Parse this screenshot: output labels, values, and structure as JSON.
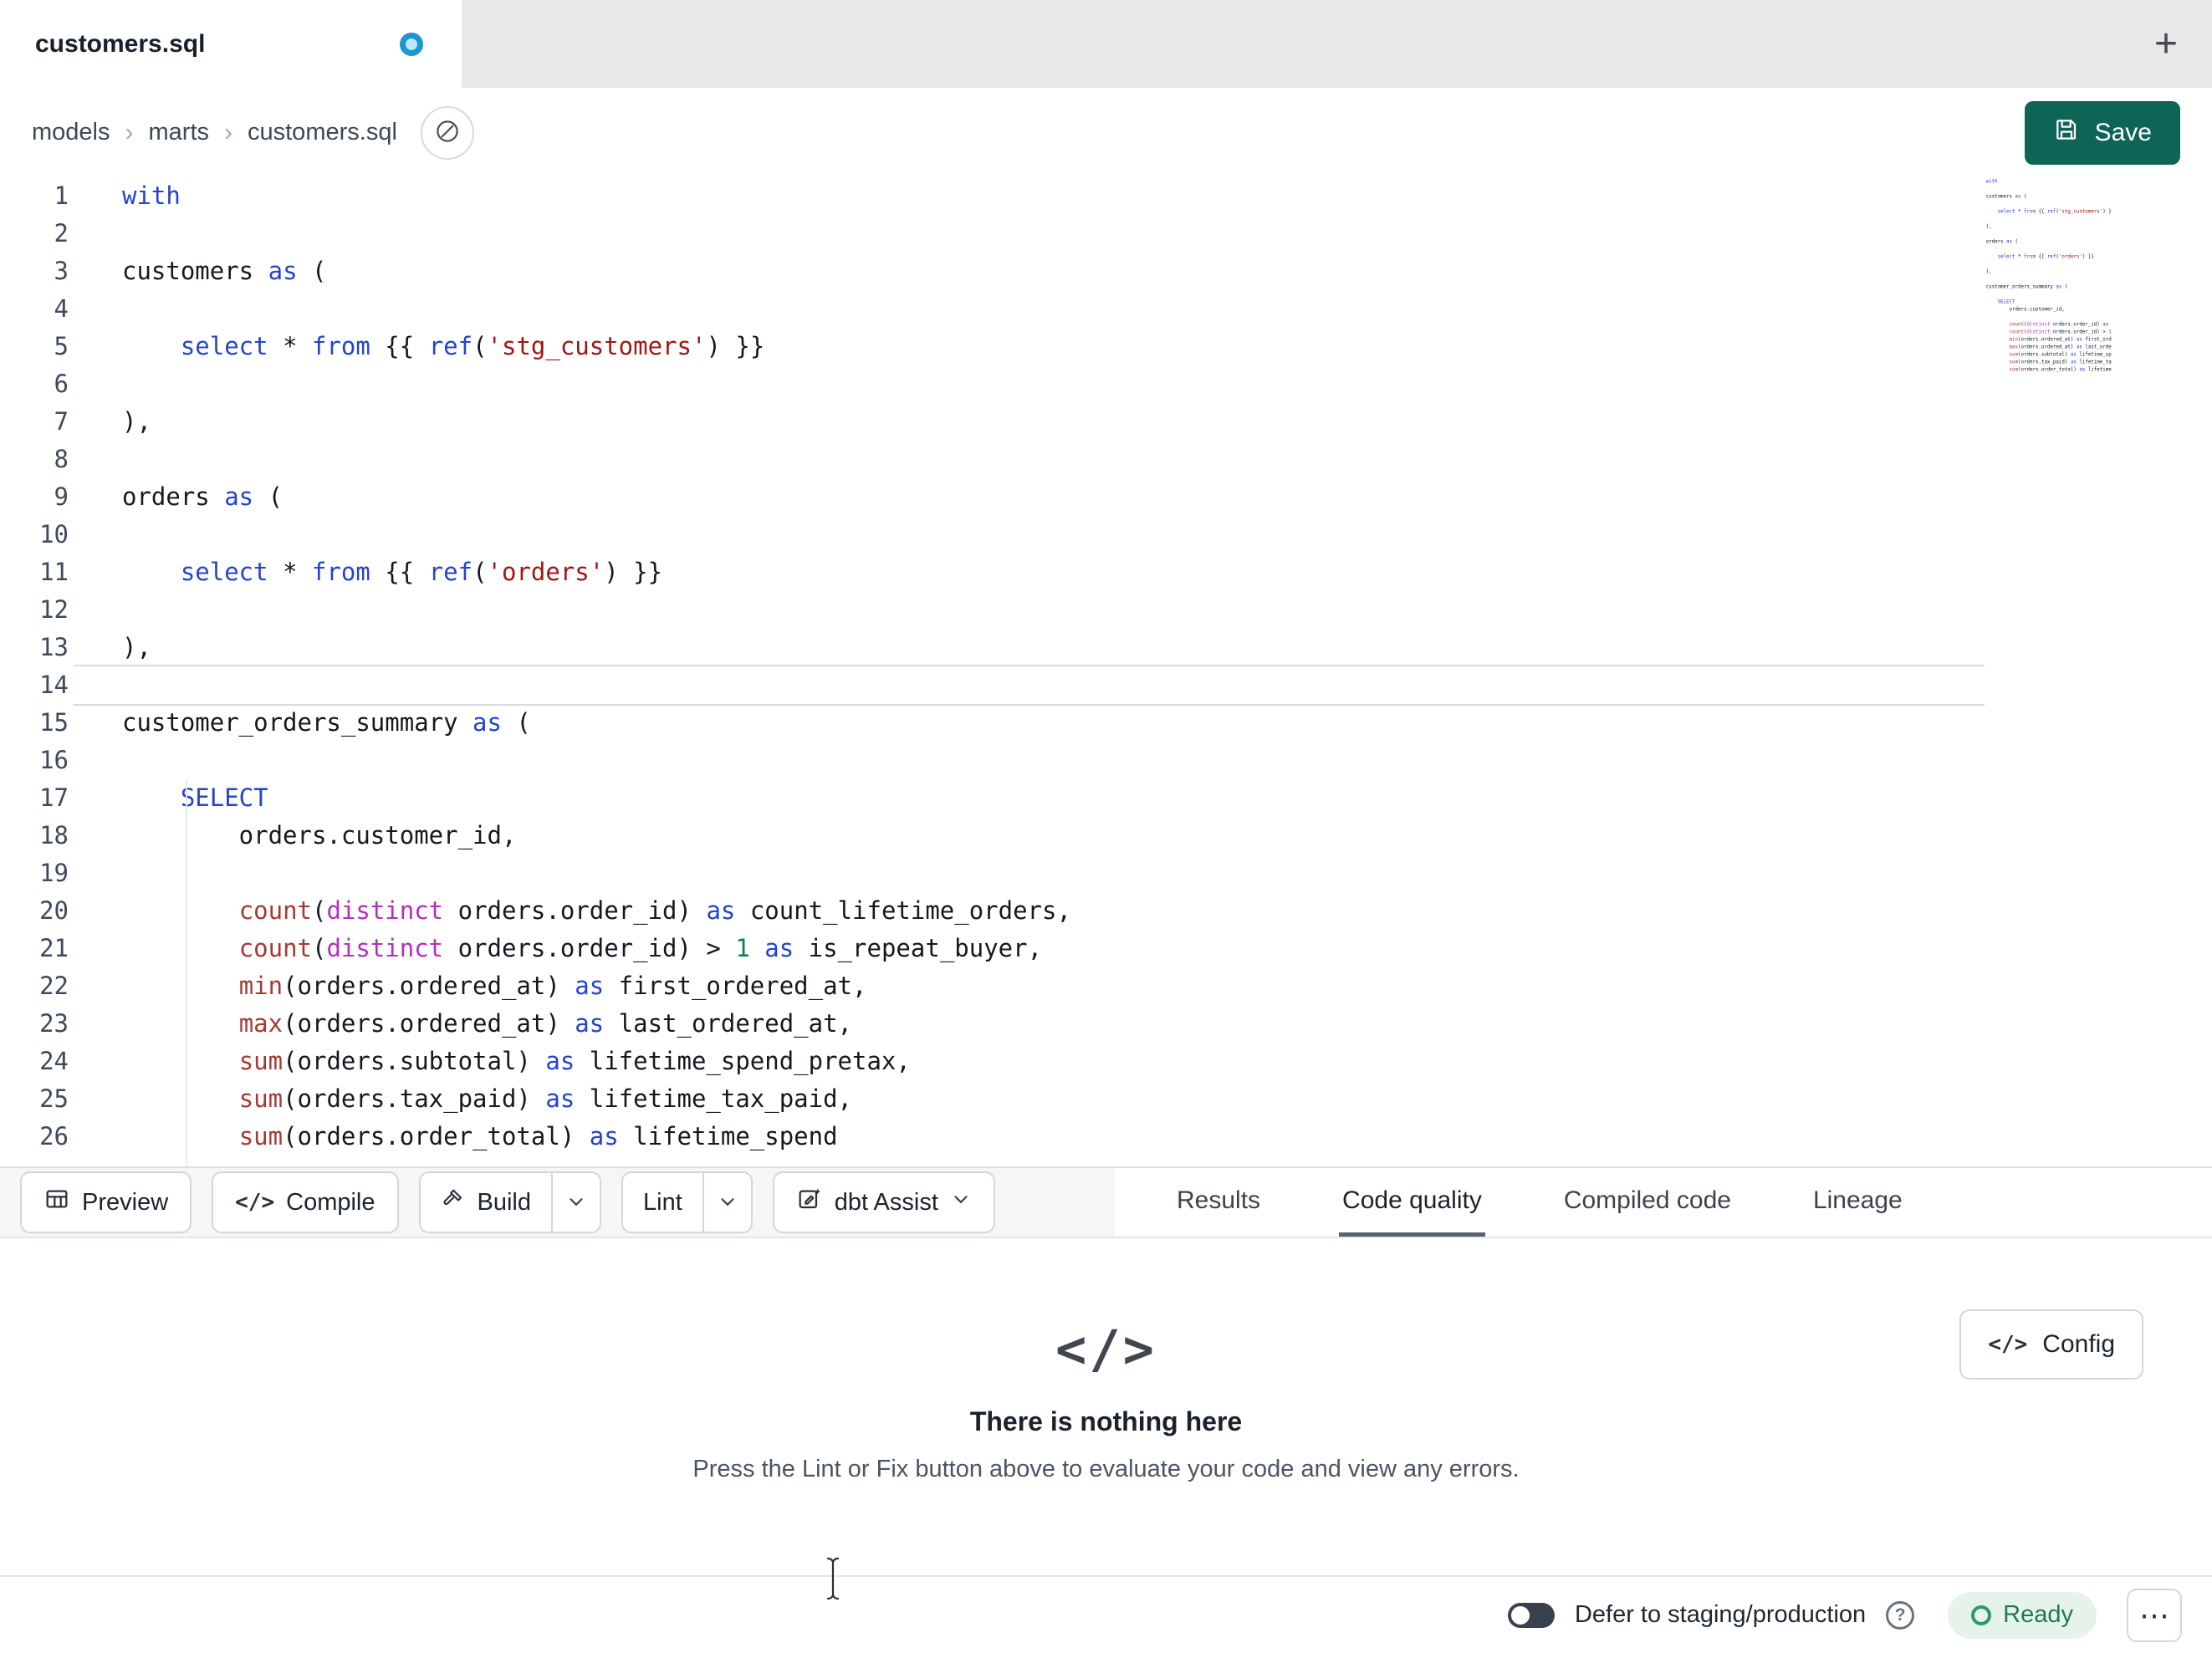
{
  "window": {
    "tab_title": "customers.sql",
    "new_tab": "+"
  },
  "breadcrumb": {
    "items": [
      "models",
      "marts",
      "customers.sql"
    ],
    "separator": "›"
  },
  "actions": {
    "save": "Save"
  },
  "editor": {
    "active_line": 14,
    "lines": [
      {
        "n": 1,
        "s": [
          [
            "with",
            "kw"
          ]
        ]
      },
      {
        "n": 2,
        "s": []
      },
      {
        "n": 3,
        "s": [
          [
            "customers ",
            "pl"
          ],
          [
            "as",
            "kw"
          ],
          [
            " (",
            "pl"
          ]
        ]
      },
      {
        "n": 4,
        "s": []
      },
      {
        "n": 5,
        "s": [
          [
            "    ",
            "pl"
          ],
          [
            "select",
            "kw"
          ],
          [
            " * ",
            "pl"
          ],
          [
            "from",
            "kw"
          ],
          [
            " {{ ",
            "pl"
          ],
          [
            "ref",
            "kw"
          ],
          [
            "(",
            "pl"
          ],
          [
            "'stg_customers'",
            "str"
          ],
          [
            ") }}",
            "pl"
          ]
        ]
      },
      {
        "n": 6,
        "s": []
      },
      {
        "n": 7,
        "s": [
          [
            "),",
            "pl"
          ]
        ]
      },
      {
        "n": 8,
        "s": []
      },
      {
        "n": 9,
        "s": [
          [
            "orders ",
            "pl"
          ],
          [
            "as",
            "kw"
          ],
          [
            " (",
            "pl"
          ]
        ]
      },
      {
        "n": 10,
        "s": []
      },
      {
        "n": 11,
        "s": [
          [
            "    ",
            "pl"
          ],
          [
            "select",
            "kw"
          ],
          [
            " * ",
            "pl"
          ],
          [
            "from",
            "kw"
          ],
          [
            " {{ ",
            "pl"
          ],
          [
            "ref",
            "kw"
          ],
          [
            "(",
            "pl"
          ],
          [
            "'orders'",
            "str"
          ],
          [
            ") }}",
            "pl"
          ]
        ]
      },
      {
        "n": 12,
        "s": []
      },
      {
        "n": 13,
        "s": [
          [
            "),",
            "pl"
          ]
        ]
      },
      {
        "n": 14,
        "s": []
      },
      {
        "n": 15,
        "s": [
          [
            "customer_orders_summary ",
            "pl"
          ],
          [
            "as",
            "kw"
          ],
          [
            " (",
            "pl"
          ]
        ]
      },
      {
        "n": 16,
        "s": []
      },
      {
        "n": 17,
        "s": [
          [
            "    ",
            "pl"
          ],
          [
            "SELECT",
            "kw"
          ]
        ]
      },
      {
        "n": 18,
        "s": [
          [
            "        orders.customer_id,",
            "pl"
          ]
        ]
      },
      {
        "n": 19,
        "s": []
      },
      {
        "n": 20,
        "s": [
          [
            "        ",
            "pl"
          ],
          [
            "count",
            "fn"
          ],
          [
            "(",
            "pl"
          ],
          [
            "distinct",
            "kw2"
          ],
          [
            " orders.order_id) ",
            "pl"
          ],
          [
            "as",
            "kw"
          ],
          [
            " count_lifetime_orders,",
            "pl"
          ]
        ]
      },
      {
        "n": 21,
        "s": [
          [
            "        ",
            "pl"
          ],
          [
            "count",
            "fn"
          ],
          [
            "(",
            "pl"
          ],
          [
            "distinct",
            "kw2"
          ],
          [
            " orders.order_id) > ",
            "pl"
          ],
          [
            "1",
            "num"
          ],
          [
            " ",
            "pl"
          ],
          [
            "as",
            "kw"
          ],
          [
            " is_repeat_buyer,",
            "pl"
          ]
        ]
      },
      {
        "n": 22,
        "s": [
          [
            "        ",
            "pl"
          ],
          [
            "min",
            "fn"
          ],
          [
            "(orders.ordered_at) ",
            "pl"
          ],
          [
            "as",
            "kw"
          ],
          [
            " first_ordered_at,",
            "pl"
          ]
        ]
      },
      {
        "n": 23,
        "s": [
          [
            "        ",
            "pl"
          ],
          [
            "max",
            "fn"
          ],
          [
            "(orders.ordered_at) ",
            "pl"
          ],
          [
            "as",
            "kw"
          ],
          [
            " last_ordered_at,",
            "pl"
          ]
        ]
      },
      {
        "n": 24,
        "s": [
          [
            "        ",
            "pl"
          ],
          [
            "sum",
            "fn"
          ],
          [
            "(orders.subtotal) ",
            "pl"
          ],
          [
            "as",
            "kw"
          ],
          [
            " lifetime_spend_pretax,",
            "pl"
          ]
        ]
      },
      {
        "n": 25,
        "s": [
          [
            "        ",
            "pl"
          ],
          [
            "sum",
            "fn"
          ],
          [
            "(orders.tax_paid) ",
            "pl"
          ],
          [
            "as",
            "kw"
          ],
          [
            " lifetime_tax_paid,",
            "pl"
          ]
        ]
      },
      {
        "n": 26,
        "s": [
          [
            "        ",
            "pl"
          ],
          [
            "sum",
            "fn"
          ],
          [
            "(orders.order_total) ",
            "pl"
          ],
          [
            "as",
            "kw"
          ],
          [
            " lifetime_spend",
            "pl"
          ]
        ]
      }
    ]
  },
  "toolbar": {
    "preview": "Preview",
    "compile": "Compile",
    "build": "Build",
    "lint": "Lint",
    "dbt_assist": "dbt Assist"
  },
  "result_tabs": [
    {
      "label": "Results",
      "active": false
    },
    {
      "label": "Code quality",
      "active": true
    },
    {
      "label": "Compiled code",
      "active": false
    },
    {
      "label": "Lineage",
      "active": false
    }
  ],
  "empty_state": {
    "icon": "</>",
    "title": "There is nothing here",
    "message": "Press the Lint or Fix button above to evaluate your code and view any errors.",
    "config": "Config"
  },
  "status_bar": {
    "defer_label": "Defer to staging/production",
    "help": "?",
    "ready": "Ready",
    "more": "⋯"
  },
  "colors": {
    "save_button": "#0d6457",
    "unsaved_dot": "#1897d3",
    "ready_text": "#1e7b4e",
    "ready_bg": "#e6f3ea",
    "tok_kw": "#2443cf",
    "tok_fn": "#a63a32",
    "tok_kw2": "#b52ec0",
    "tok_str": "#a31515",
    "tok_num": "#0e7e55"
  }
}
